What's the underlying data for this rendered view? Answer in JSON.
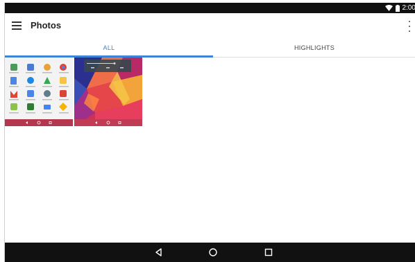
{
  "status_bar": {
    "time": "2:00"
  },
  "app_bar": {
    "title": "Photos"
  },
  "tabs": [
    {
      "label": "ALL",
      "selected": true
    },
    {
      "label": "HIGHLIGHTS",
      "selected": false
    }
  ],
  "photos": [
    {
      "name": "screenshot-app-drawer"
    },
    {
      "name": "wallpaper-geometric"
    }
  ],
  "icons": {
    "menu": "menu-icon",
    "overflow": "more-vert-icon",
    "back": "back-icon",
    "home": "home-icon",
    "recents": "recents-icon"
  },
  "colors": {
    "accent": "#3d84d6",
    "status_bar": "#111111",
    "nav_bar": "#111111"
  }
}
